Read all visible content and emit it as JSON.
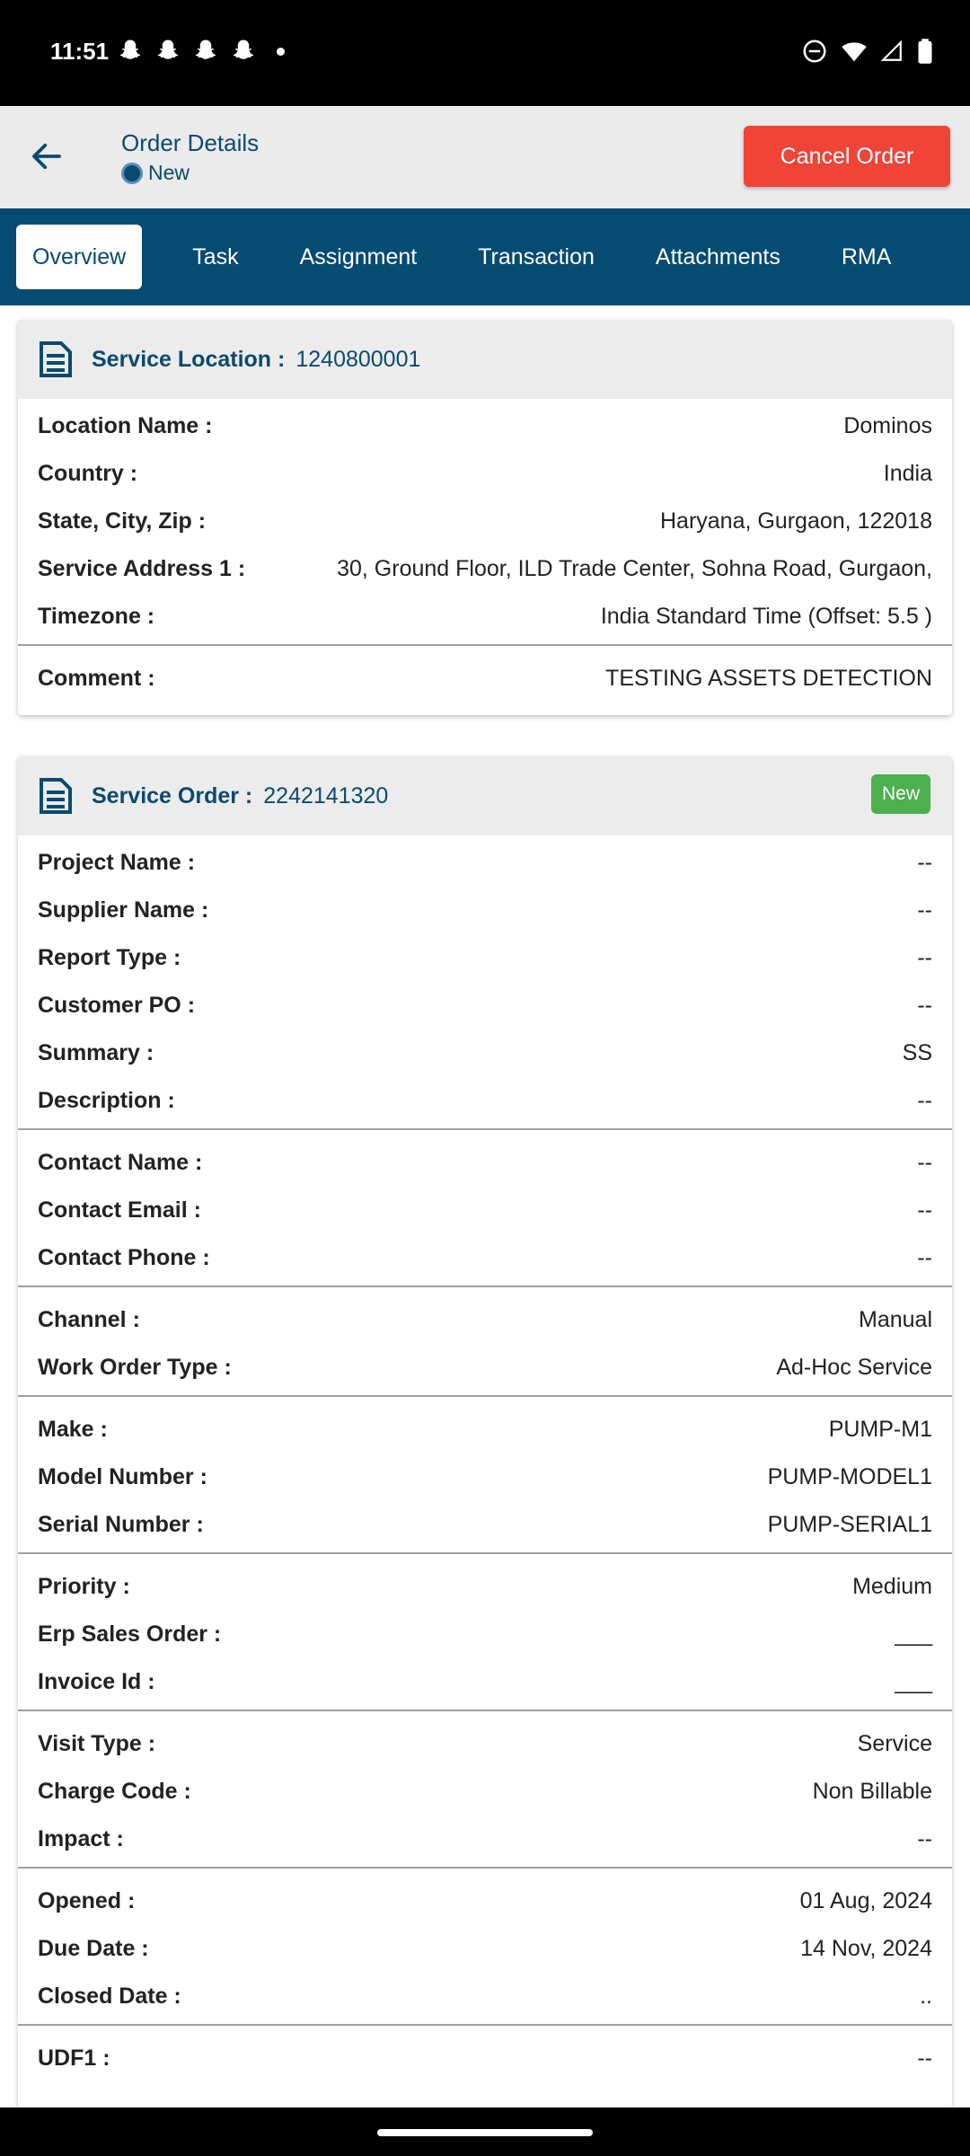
{
  "status_bar": {
    "time": "11:51",
    "notifications": [
      "snapchat-icon",
      "snapchat-icon",
      "snapchat-icon",
      "snapchat-icon"
    ],
    "system_icons": [
      "dnd-icon",
      "wifi-icon",
      "signal-icon",
      "battery-icon"
    ]
  },
  "header": {
    "title": "Order Details",
    "status": "New",
    "cancel_label": "Cancel Order"
  },
  "tabs": [
    "Overview",
    "Task",
    "Assignment",
    "Transaction",
    "Attachments",
    "RMA"
  ],
  "service_location": {
    "label": "Service Location :",
    "id": "1240800001",
    "rows": [
      {
        "k": "Location Name :",
        "v": "Dominos"
      },
      {
        "k": "Country :",
        "v": "India"
      },
      {
        "k": "State, City, Zip :",
        "v": "Haryana, Gurgaon, 122018"
      },
      {
        "k": "Service Address 1 :",
        "v": "30, Ground Floor, ILD Trade Center, Sohna Road, Gurgaon,"
      },
      {
        "k": "Timezone :",
        "v": "India Standard Time (Offset: 5.5 )"
      }
    ],
    "comment": {
      "k": "Comment :",
      "v": "TESTING ASSETS DETECTION"
    }
  },
  "service_order": {
    "label": "Service Order :",
    "id": "2242141320",
    "badge": "New",
    "groups": [
      [
        {
          "k": "Project Name :",
          "v": "--"
        },
        {
          "k": "Supplier Name :",
          "v": "--"
        },
        {
          "k": "Report Type :",
          "v": "--"
        },
        {
          "k": "Customer PO :",
          "v": "--"
        },
        {
          "k": "Summary :",
          "v": "SS"
        },
        {
          "k": "Description :",
          "v": "--"
        }
      ],
      [
        {
          "k": "Contact Name :",
          "v": "--"
        },
        {
          "k": "Contact Email :",
          "v": "--"
        },
        {
          "k": "Contact Phone :",
          "v": "--"
        }
      ],
      [
        {
          "k": "Channel :",
          "v": "Manual"
        },
        {
          "k": "Work Order Type :",
          "v": "Ad-Hoc Service"
        }
      ],
      [
        {
          "k": "Make :",
          "v": "PUMP-M1"
        },
        {
          "k": "Model Number :",
          "v": "PUMP-MODEL1"
        },
        {
          "k": "Serial Number :",
          "v": "PUMP-SERIAL1"
        }
      ],
      [
        {
          "k": "Priority :",
          "v": "Medium"
        },
        {
          "k": "Erp Sales Order :",
          "v": "___"
        },
        {
          "k": "Invoice Id :",
          "v": "___"
        }
      ],
      [
        {
          "k": "Visit Type :",
          "v": "Service"
        },
        {
          "k": "Charge Code :",
          "v": "Non Billable"
        },
        {
          "k": "Impact :",
          "v": "--"
        }
      ],
      [
        {
          "k": "Opened :",
          "v": "01 Aug, 2024"
        },
        {
          "k": "Due Date :",
          "v": "14 Nov, 2024"
        },
        {
          "k": "Closed Date :",
          "v": ".."
        }
      ],
      [
        {
          "k": "UDF1 :",
          "v": "--"
        }
      ]
    ]
  },
  "colors": {
    "primary": "#064b72",
    "danger": "#f04438",
    "success": "#4caf50"
  }
}
